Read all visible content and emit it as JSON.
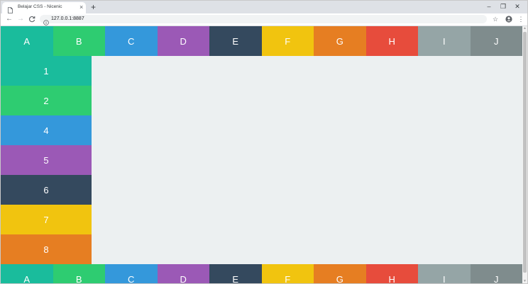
{
  "browser": {
    "tab_title": "Belajar CSS - Nicenic",
    "tab_close": "×",
    "new_tab": "+",
    "window_controls": {
      "minimize": "–",
      "restore": "❐",
      "close": "✕"
    },
    "nav": {
      "back": "←",
      "forward": "→",
      "reload": "C"
    },
    "url": "127.0.0.1:8887",
    "star": "☆",
    "menu": "⋮",
    "icons": [
      "doc-icon",
      "info-icon",
      "account-icon"
    ]
  },
  "page": {
    "top_row": [
      {
        "label": "A",
        "color": "#1abc9c"
      },
      {
        "label": "B",
        "color": "#2ecc71"
      },
      {
        "label": "C",
        "color": "#3498db"
      },
      {
        "label": "D",
        "color": "#9b59b6"
      },
      {
        "label": "E",
        "color": "#34495e"
      },
      {
        "label": "F",
        "color": "#f1c40f"
      },
      {
        "label": "G",
        "color": "#e67e22"
      },
      {
        "label": "H",
        "color": "#e74c3c"
      },
      {
        "label": "I",
        "color": "#95a5a6"
      },
      {
        "label": "J",
        "color": "#7f8c8d"
      }
    ],
    "side_column": [
      {
        "label": "1",
        "color": "#1abc9c"
      },
      {
        "label": "2",
        "color": "#2ecc71"
      },
      {
        "label": "4",
        "color": "#3498db"
      },
      {
        "label": "5",
        "color": "#9b59b6"
      },
      {
        "label": "6",
        "color": "#34495e"
      },
      {
        "label": "7",
        "color": "#f1c40f"
      },
      {
        "label": "8",
        "color": "#e67e22"
      }
    ],
    "bottom_row": [
      {
        "label": "A",
        "color": "#1abc9c"
      },
      {
        "label": "B",
        "color": "#2ecc71"
      },
      {
        "label": "C",
        "color": "#3498db"
      },
      {
        "label": "D",
        "color": "#9b59b6"
      },
      {
        "label": "E",
        "color": "#34495e"
      },
      {
        "label": "F",
        "color": "#f1c40f"
      },
      {
        "label": "G",
        "color": "#e67e22"
      },
      {
        "label": "H",
        "color": "#e74c3c"
      },
      {
        "label": "I",
        "color": "#95a5a6"
      },
      {
        "label": "J",
        "color": "#7f8c8d"
      }
    ],
    "main_bg": "#ecf0f1"
  },
  "scrollbar": {
    "up": "▲",
    "down": "▼"
  }
}
